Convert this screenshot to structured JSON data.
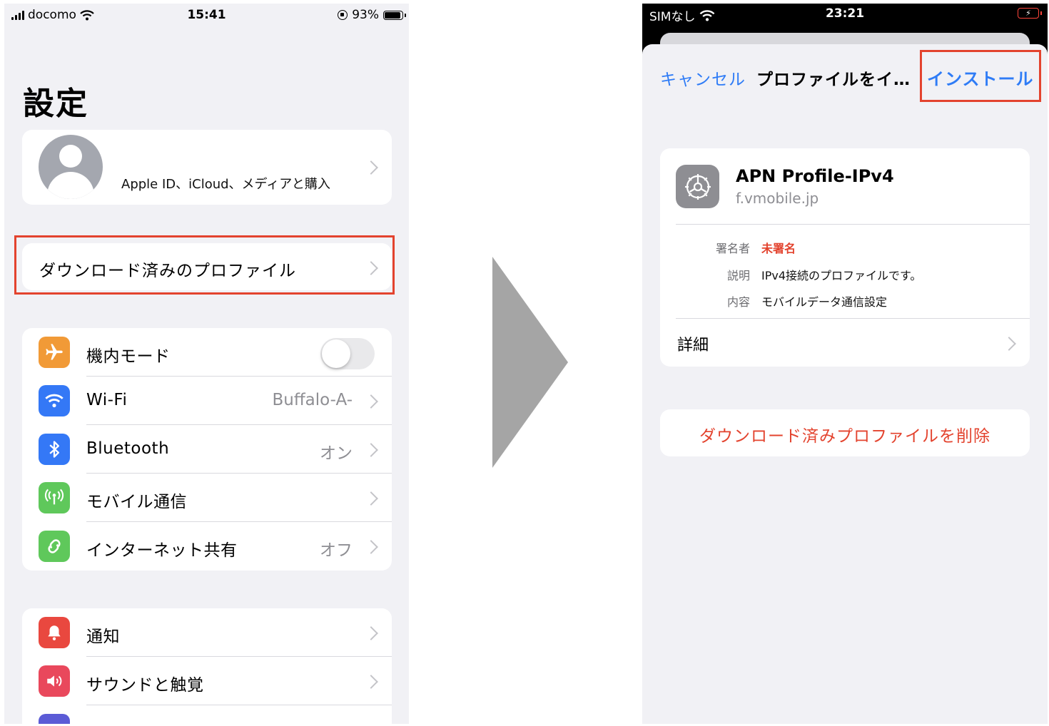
{
  "left_screen": {
    "status_bar": {
      "carrier": "docomo",
      "time": "15:41",
      "battery_percent": "93%",
      "battery_level": 0.93
    },
    "title": "設定",
    "apple_id_label": "Apple ID、iCloud、メディアと購入",
    "downloaded_profile_label": "ダウンロード済みのプロファイル",
    "group1": [
      {
        "label": "機内モード",
        "icon": "airplane-icon",
        "color": "#f19a37",
        "toggle": false
      },
      {
        "label": "Wi-Fi",
        "value": "Buffalo-A-",
        "icon": "wifi-icon",
        "color": "#3478f6"
      },
      {
        "label": "Bluetooth",
        "value": "オン",
        "icon": "bluetooth-icon",
        "color": "#3478f6"
      },
      {
        "label": "モバイル通信",
        "value": "",
        "icon": "antenna-icon",
        "color": "#5fc85b"
      },
      {
        "label": "インターネット共有",
        "value": "オフ",
        "icon": "link-icon",
        "color": "#5fc85b"
      }
    ],
    "group2": [
      {
        "label": "通知",
        "icon": "bell-icon",
        "color": "#e9483f"
      },
      {
        "label": "サウンドと触覚",
        "icon": "speaker-icon",
        "color": "#e9485c"
      }
    ]
  },
  "right_screen": {
    "status_bar": {
      "carrier": "SIMなし",
      "time": "23:21"
    },
    "nav": {
      "cancel": "キャンセル",
      "title": "プロファイルをイ…",
      "install": "インストール"
    },
    "profile": {
      "name": "APN Profile-IPv4",
      "domain": "f.vmobile.jp",
      "signer_key": "署名者",
      "signer_value": "未署名",
      "description_key": "説明",
      "description_value": "IPv4接続のプロファイルです。",
      "contents_key": "内容",
      "contents_value": "モバイルデータ通信設定",
      "details": "詳細"
    },
    "delete_label": "ダウンロード済みプロファイルを削除"
  },
  "colors": {
    "accent_blue": "#2f7cf6",
    "highlight_red": "#e3432e",
    "arrow_gray": "#a5a5a5"
  }
}
